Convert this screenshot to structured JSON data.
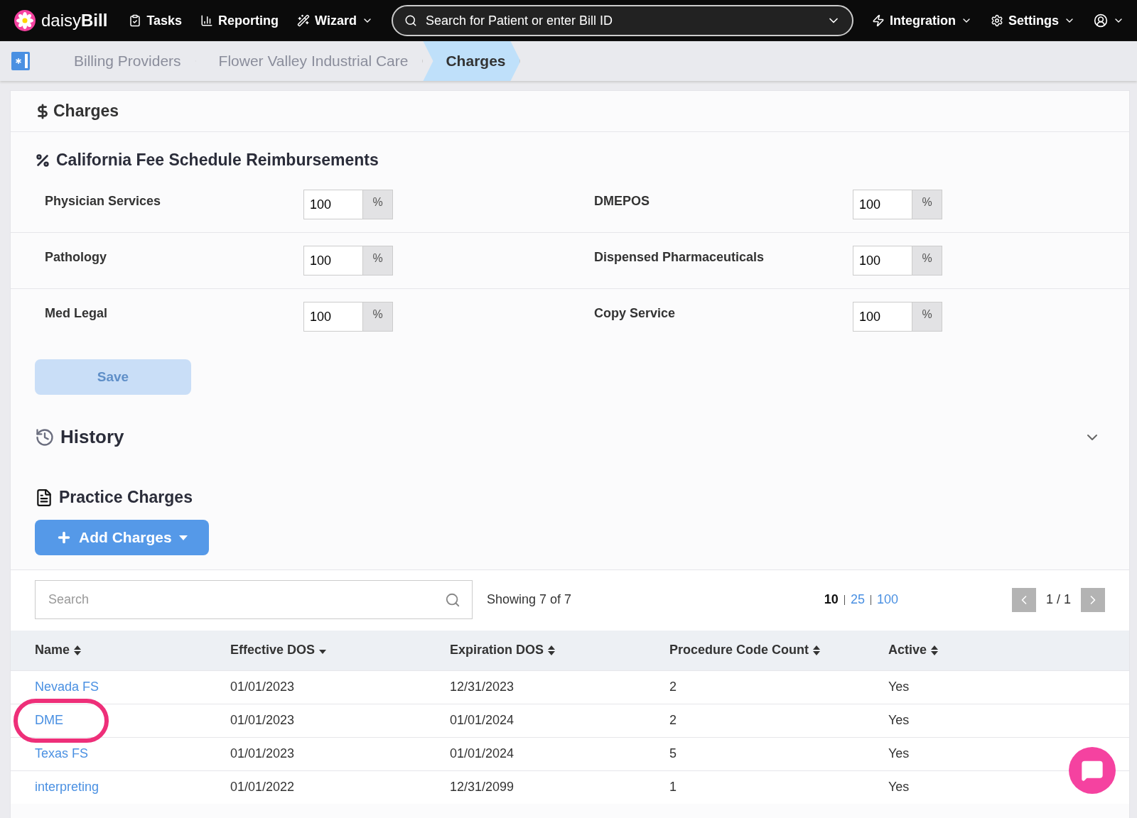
{
  "nav": {
    "brand": {
      "light": "daisy",
      "bold": "Bill"
    },
    "items": [
      {
        "label": "Tasks",
        "kind": "tasks",
        "dropdown": false
      },
      {
        "label": "Reporting",
        "kind": "reporting",
        "dropdown": false
      },
      {
        "label": "Wizard",
        "kind": "wizard",
        "dropdown": true
      }
    ],
    "search": {
      "placeholder": "Search for Patient or enter Bill ID"
    },
    "right_items": [
      {
        "label": "Integration",
        "kind": "integration"
      },
      {
        "label": "Settings",
        "kind": "settings"
      }
    ]
  },
  "breadcrumbs": [
    {
      "label": "Billing Providers",
      "selected": false
    },
    {
      "label": "Flower Valley Industrial Care",
      "selected": false
    },
    {
      "label": "Charges",
      "selected": true
    }
  ],
  "page_title": "Charges",
  "fee_schedule": {
    "title": "California Fee Schedule Reimbursements",
    "fields": [
      {
        "label": "Physician Services",
        "value": "100",
        "unit": "%"
      },
      {
        "label": "DMEPOS",
        "value": "100",
        "unit": "%"
      },
      {
        "label": "Pathology",
        "value": "100",
        "unit": "%"
      },
      {
        "label": "Dispensed Pharmaceuticals",
        "value": "100",
        "unit": "%"
      },
      {
        "label": "Med Legal",
        "value": "100",
        "unit": "%"
      },
      {
        "label": "Copy Service",
        "value": "100",
        "unit": "%"
      }
    ],
    "save": {
      "label": "Save",
      "disabled": true
    }
  },
  "history": {
    "title": "History",
    "expanded": false
  },
  "practice_charges": {
    "title": "Practice Charges",
    "add_button": "Add Charges",
    "search": {
      "placeholder": "Search"
    },
    "showing": "Showing 7 of 7",
    "page_sizes": [
      {
        "label": "10",
        "selected": true
      },
      {
        "label": "25",
        "selected": false
      },
      {
        "label": "100",
        "selected": false
      }
    ],
    "pager": "1 / 1",
    "columns": [
      {
        "label": "Name",
        "sorted": false
      },
      {
        "label": "Effective DOS",
        "sorted": true
      },
      {
        "label": "Expiration DOS",
        "sorted": false
      },
      {
        "label": "Procedure Code Count",
        "sorted": false
      },
      {
        "label": "Active",
        "sorted": false
      }
    ],
    "rows": [
      {
        "name": "Nevada FS",
        "effective": "01/01/2023",
        "expiration": "12/31/2023",
        "count": "2",
        "active": "Yes",
        "highlighted": false
      },
      {
        "name": "DME",
        "effective": "01/01/2023",
        "expiration": "01/01/2024",
        "count": "2",
        "active": "Yes",
        "highlighted": true
      },
      {
        "name": "Texas FS",
        "effective": "01/01/2023",
        "expiration": "01/01/2024",
        "count": "5",
        "active": "Yes",
        "highlighted": false
      },
      {
        "name": "interpreting",
        "effective": "01/01/2022",
        "expiration": "12/31/2099",
        "count": "1",
        "active": "Yes",
        "highlighted": false
      }
    ]
  }
}
